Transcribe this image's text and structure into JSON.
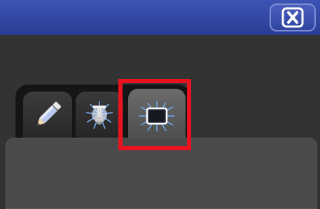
{
  "window": {
    "titlebar_color": "#3247a8",
    "close_icon": "close-x-icon"
  },
  "tabs": [
    {
      "icon": "pencil-icon",
      "selected": false
    },
    {
      "icon": "spotlight-fixture-icon",
      "selected": false
    },
    {
      "icon": "glowing-screen-icon",
      "selected": true
    }
  ],
  "highlight": {
    "color": "#e8131f",
    "target": "tab-screen"
  }
}
